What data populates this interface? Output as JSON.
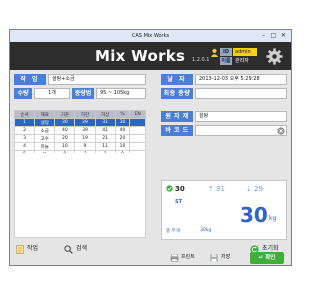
{
  "window": {
    "title": "CAS Mix Works"
  },
  "header": {
    "app_title": "Mix Works",
    "version": "1.2.0.1",
    "user": {
      "id_label": "ID",
      "id_value": "admin",
      "role_label": "이름",
      "role_value": "관리자"
    }
  },
  "form": {
    "work_label": "작 업",
    "work_value": "설탕+소금",
    "date_label": "날 자",
    "date_value": "2013-12-03 오후 5:29:28",
    "qty_label": "수량",
    "qty_value": "1개",
    "weight_range_label": "중량범",
    "weight_range_value": "95 ~ 105kg",
    "final_weight_label": "최종 중량",
    "final_weight_value": "",
    "material_label": "원 자 재",
    "material_value": "설탕",
    "barcode_label": "바 코 드",
    "barcode_value": ""
  },
  "grid": {
    "headers": [
      "순서",
      "재료",
      "기준",
      "허한",
      "허상",
      "%",
      "EN"
    ],
    "rows": [
      [
        "1",
        "설탕",
        "30",
        "29",
        "31",
        "30",
        ""
      ],
      [
        "2",
        "소금",
        "40",
        "39",
        "41",
        "40",
        ""
      ],
      [
        "3",
        "고수",
        "20",
        "19",
        "21",
        "20",
        ""
      ],
      [
        "4",
        "마늘",
        "10",
        "9",
        "11",
        "10",
        ""
      ],
      [
        "5",
        "물",
        "0",
        "-1",
        "1",
        "0",
        ""
      ]
    ]
  },
  "weigh": {
    "target": "30",
    "upper": "31",
    "lower": "29",
    "status": "ST",
    "value": "30",
    "unit": "kg",
    "tare_label": "총 무게",
    "tare_value": "30kg"
  },
  "buttons": {
    "print": "프린트",
    "save": "저장",
    "ok": "확인",
    "work": "작업",
    "search": "검색",
    "reset": "초기화"
  },
  "colors": {
    "accent": "#4a7fd4",
    "header_bg": "#2d2d2d",
    "ok": "#3fae38",
    "selected_row": "#2f63c9"
  }
}
